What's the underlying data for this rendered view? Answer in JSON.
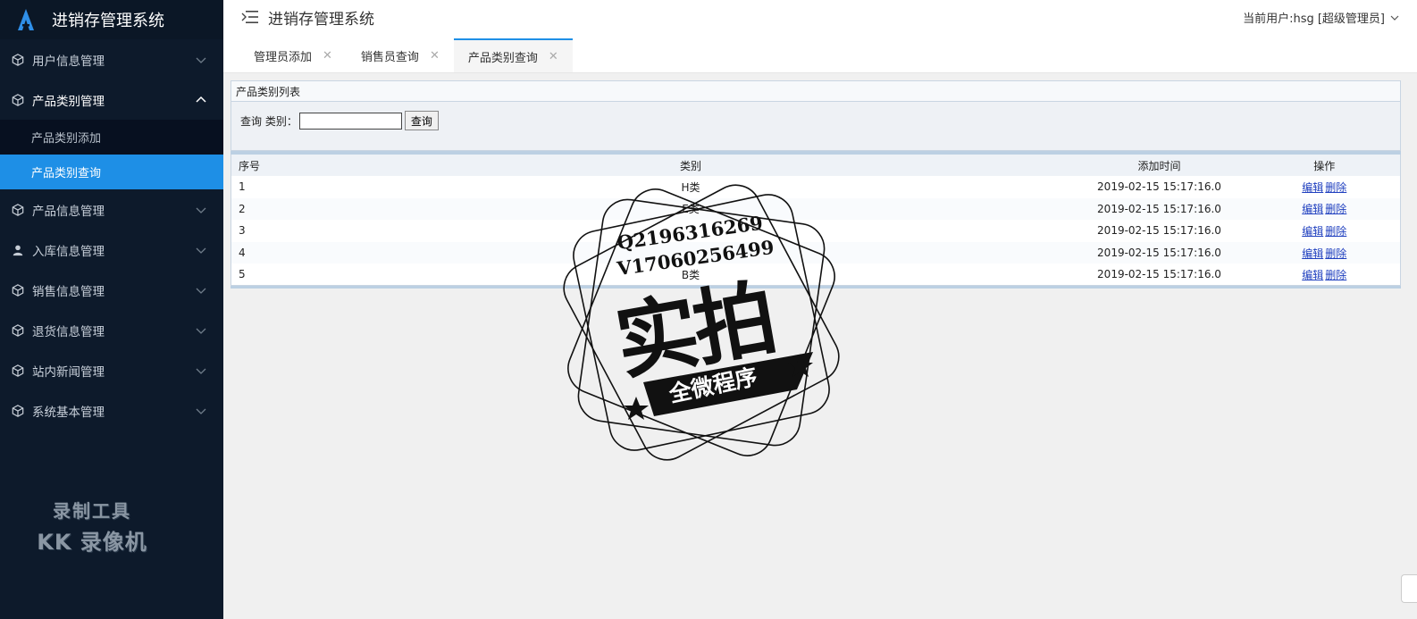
{
  "app": {
    "brand_title": "进销存管理系统",
    "header_title": "进销存管理系统",
    "user_info": "当前用户:hsg [超级管理员]"
  },
  "sidebar": {
    "items": [
      {
        "label": "用户信息管理",
        "icon": "cube-icon",
        "open": false
      },
      {
        "label": "产品类别管理",
        "icon": "cube-icon",
        "open": true,
        "sub": [
          {
            "label": "产品类别添加",
            "active": false
          },
          {
            "label": "产品类别查询",
            "active": true
          }
        ]
      },
      {
        "label": "产品信息管理",
        "icon": "cube-icon",
        "open": false
      },
      {
        "label": "入库信息管理",
        "icon": "user-icon",
        "open": false
      },
      {
        "label": "销售信息管理",
        "icon": "cube-icon",
        "open": false
      },
      {
        "label": "退货信息管理",
        "icon": "cube-icon",
        "open": false
      },
      {
        "label": "站内新闻管理",
        "icon": "cube-icon",
        "open": false
      },
      {
        "label": "系统基本管理",
        "icon": "cube-icon",
        "open": false
      }
    ],
    "recorder_line1": "录制工具",
    "recorder_line2": "KK 录像机"
  },
  "tabs": [
    {
      "label": "管理员添加",
      "active": false
    },
    {
      "label": "销售员查询",
      "active": false
    },
    {
      "label": "产品类别查询",
      "active": true
    }
  ],
  "panel": {
    "title": "产品类别列表",
    "query_label": "查询 类别：",
    "query_value": "",
    "query_button": "查询"
  },
  "table": {
    "headers": {
      "idx": "序号",
      "category": "类别",
      "time": "添加时间",
      "ops": "操作"
    },
    "rows": [
      {
        "idx": "1",
        "category": "H类",
        "time": "2019-02-15 15:17:16.0"
      },
      {
        "idx": "2",
        "category": "E类",
        "time": "2019-02-15 15:17:16.0"
      },
      {
        "idx": "3",
        "category": "",
        "time": "2019-02-15 15:17:16.0"
      },
      {
        "idx": "4",
        "category": "",
        "time": "2019-02-15 15:17:16.0"
      },
      {
        "idx": "5",
        "category": "B类",
        "time": "2019-02-15 15:17:16.0"
      }
    ],
    "edit_label": "编辑",
    "delete_label": "删除"
  },
  "stamp": {
    "line_q": "Q2196316269",
    "line_v": "V17060256499",
    "big": "实拍",
    "banner": "全微程序"
  },
  "colors": {
    "sidebar_bg": "#0d1a2b",
    "accent": "#1e8fe6",
    "link": "#1f3fbf"
  }
}
